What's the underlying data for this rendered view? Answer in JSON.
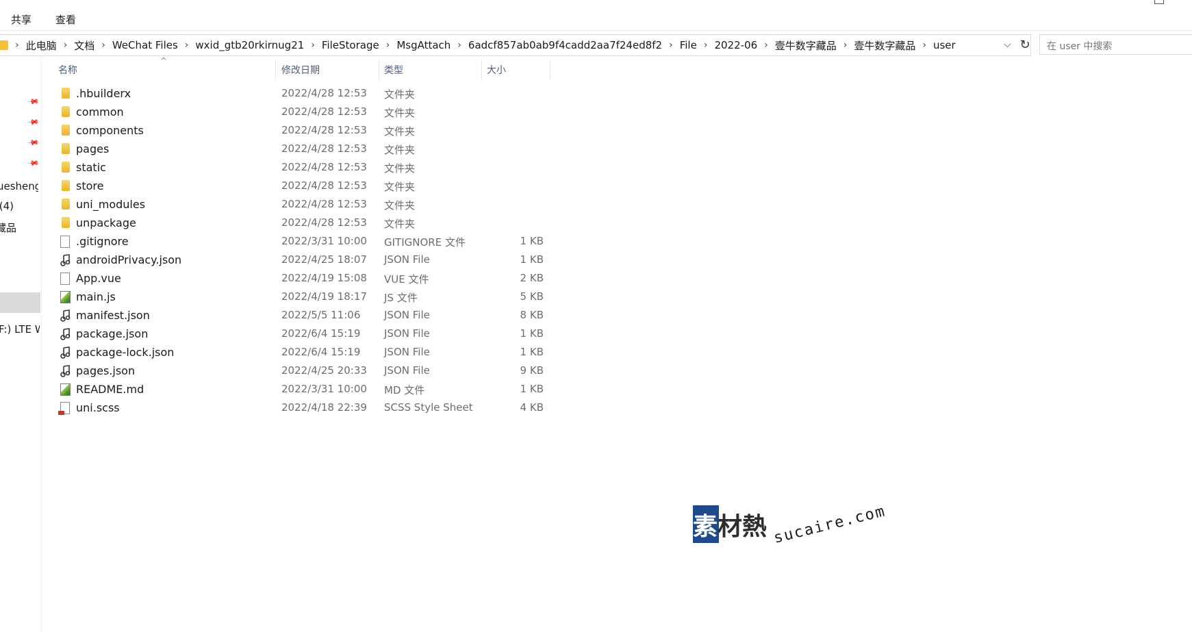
{
  "ribbon": {
    "tabs": [
      "共享",
      "查看"
    ]
  },
  "address": {
    "crumbs": [
      "此电脑",
      "文档",
      "WeChat Files",
      "wxid_gtb20rkirnug21",
      "FileStorage",
      "MsgAttach",
      "6adcf857ab0ab9f4cadd2aa7f24ed8f2",
      "File",
      "2022-06",
      "壹牛数字藏品",
      "壹牛数字藏品",
      "user"
    ],
    "separator": "›",
    "dropdown_glyph": "⌵",
    "refresh_glyph": "↻"
  },
  "search": {
    "placeholder": "在 user 中搜索"
  },
  "nav": {
    "items": [
      "uesheng.",
      "⁠ (4)",
      "藏品",
      "F:) LTE W"
    ]
  },
  "columns": {
    "name": "名称",
    "date": "修改日期",
    "type": "类型",
    "size": "大小"
  },
  "files": [
    {
      "name": ".hbuilderx",
      "date": "2022/4/28 12:53",
      "type": "文件夹",
      "size": "",
      "icon": "folder-icon"
    },
    {
      "name": "common",
      "date": "2022/4/28 12:53",
      "type": "文件夹",
      "size": "",
      "icon": "folder-icon"
    },
    {
      "name": "components",
      "date": "2022/4/28 12:53",
      "type": "文件夹",
      "size": "",
      "icon": "folder-icon"
    },
    {
      "name": "pages",
      "date": "2022/4/28 12:53",
      "type": "文件夹",
      "size": "",
      "icon": "folder-icon"
    },
    {
      "name": "static",
      "date": "2022/4/28 12:53",
      "type": "文件夹",
      "size": "",
      "icon": "folder-icon"
    },
    {
      "name": "store",
      "date": "2022/4/28 12:53",
      "type": "文件夹",
      "size": "",
      "icon": "folder-icon"
    },
    {
      "name": "uni_modules",
      "date": "2022/4/28 12:53",
      "type": "文件夹",
      "size": "",
      "icon": "folder-icon"
    },
    {
      "name": "unpackage",
      "date": "2022/4/28 12:53",
      "type": "文件夹",
      "size": "",
      "icon": "folder-icon"
    },
    {
      "name": ".gitignore",
      "date": "2022/3/31 10:00",
      "type": "GITIGNORE 文件",
      "size": "1 KB",
      "icon": "file-icon"
    },
    {
      "name": "androidPrivacy.json",
      "date": "2022/4/25 18:07",
      "type": "JSON File",
      "size": "1 KB",
      "icon": "json-file-icon"
    },
    {
      "name": "App.vue",
      "date": "2022/4/19 15:08",
      "type": "VUE 文件",
      "size": "2 KB",
      "icon": "file-icon"
    },
    {
      "name": "main.js",
      "date": "2022/4/19 18:17",
      "type": "JS 文件",
      "size": "5 KB",
      "icon": "js-file-icon"
    },
    {
      "name": "manifest.json",
      "date": "2022/5/5 11:06",
      "type": "JSON File",
      "size": "8 KB",
      "icon": "json-file-icon"
    },
    {
      "name": "package.json",
      "date": "2022/6/4 15:19",
      "type": "JSON File",
      "size": "1 KB",
      "icon": "json-file-icon"
    },
    {
      "name": "package-lock.json",
      "date": "2022/6/4 15:19",
      "type": "JSON File",
      "size": "1 KB",
      "icon": "json-file-icon"
    },
    {
      "name": "pages.json",
      "date": "2022/4/25 20:33",
      "type": "JSON File",
      "size": "9 KB",
      "icon": "json-file-icon"
    },
    {
      "name": "README.md",
      "date": "2022/3/31 10:00",
      "type": "MD 文件",
      "size": "1 KB",
      "icon": "js-file-icon"
    },
    {
      "name": "uni.scss",
      "date": "2022/4/18 22:39",
      "type": "SCSS Style Sheet",
      "size": "4 KB",
      "icon": "scss-file-icon"
    }
  ],
  "watermark": {
    "cn_first": "素",
    "cn_rest": "材熱",
    "en": "sucaire.com"
  },
  "colors": {
    "folder": "#f3c13d",
    "header_text": "#4c607a",
    "selection": "#d9d9d9"
  }
}
